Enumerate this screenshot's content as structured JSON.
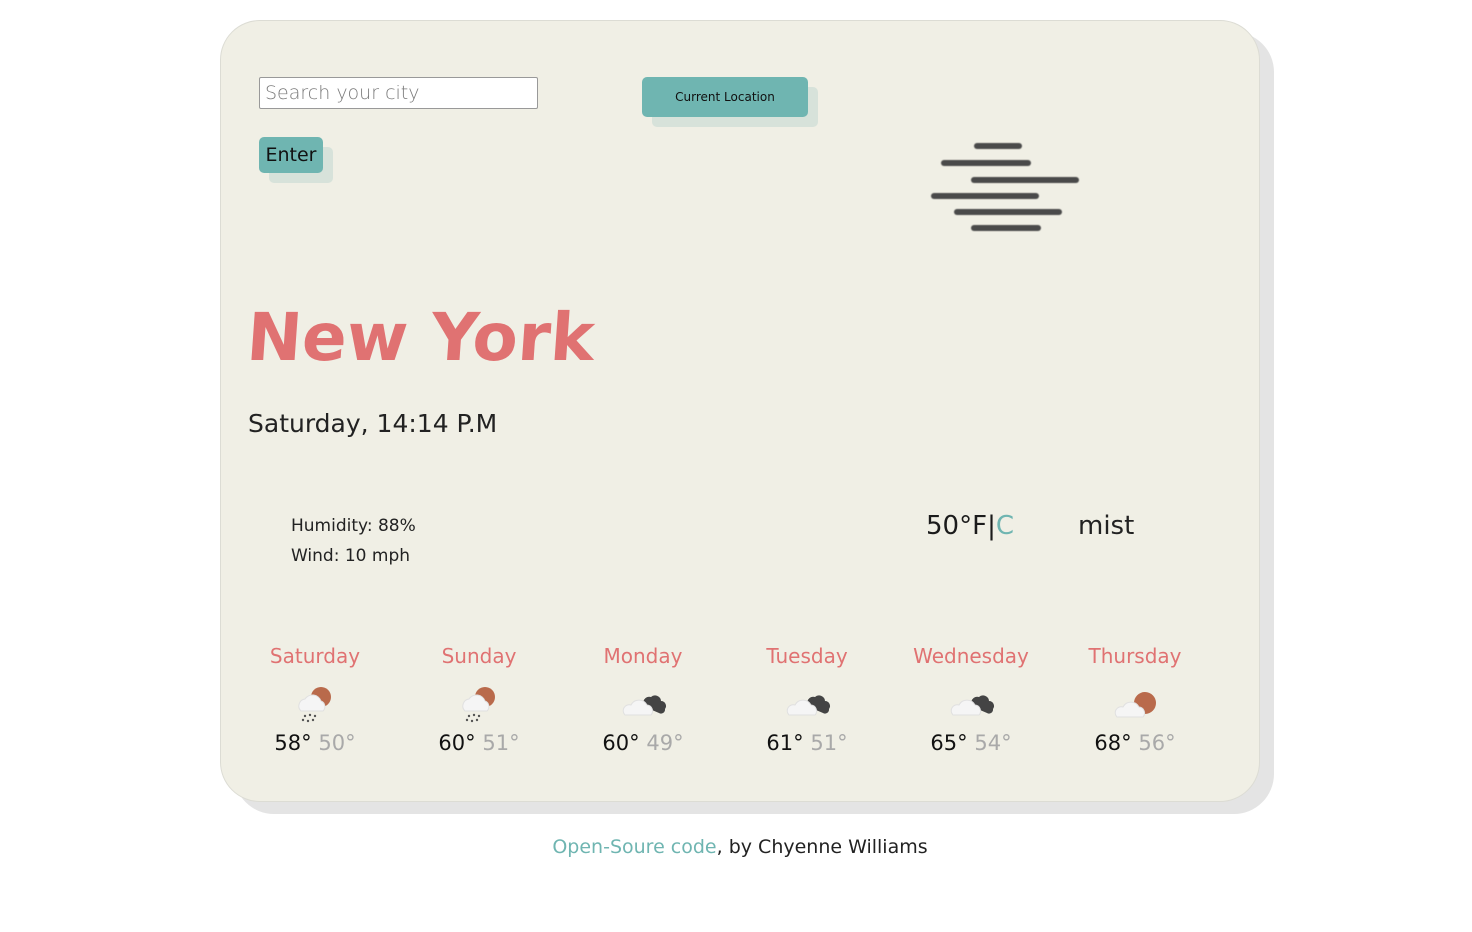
{
  "search": {
    "placeholder": "Search your city",
    "value": "",
    "enter_label": "Enter",
    "current_location_label": "Current Location"
  },
  "current": {
    "icon": "mist-icon",
    "city": "New York",
    "datetime": "Saturday, 14:14 P.M",
    "humidity": "Humidity: 88%",
    "wind": "Wind: 10 mph",
    "temperature": "50",
    "unit_f": "°F",
    "separator": "|",
    "unit_c": "C",
    "description": "mist"
  },
  "forecast": [
    {
      "day": "Saturday",
      "icon": "rain-sun-icon",
      "high": "58°",
      "low": "50°"
    },
    {
      "day": "Sunday",
      "icon": "rain-sun-icon",
      "high": "60°",
      "low": "51°"
    },
    {
      "day": "Monday",
      "icon": "broken-clouds-icon",
      "high": "60°",
      "low": "49°"
    },
    {
      "day": "Tuesday",
      "icon": "broken-clouds-icon",
      "high": "61°",
      "low": "51°"
    },
    {
      "day": "Wednesday",
      "icon": "broken-clouds-icon",
      "high": "65°",
      "low": "54°"
    },
    {
      "day": "Thursday",
      "icon": "partly-cloudy-icon",
      "high": "68°",
      "low": "56°"
    }
  ],
  "footer": {
    "link_text": "Open-Soure code",
    "text": ", by Chyenne Williams"
  },
  "colors": {
    "accent": "#6fb5b1",
    "city": "#e07272",
    "card_bg": "#f0efe5",
    "sun": "#b96a4b",
    "dark_cloud": "#444444"
  }
}
